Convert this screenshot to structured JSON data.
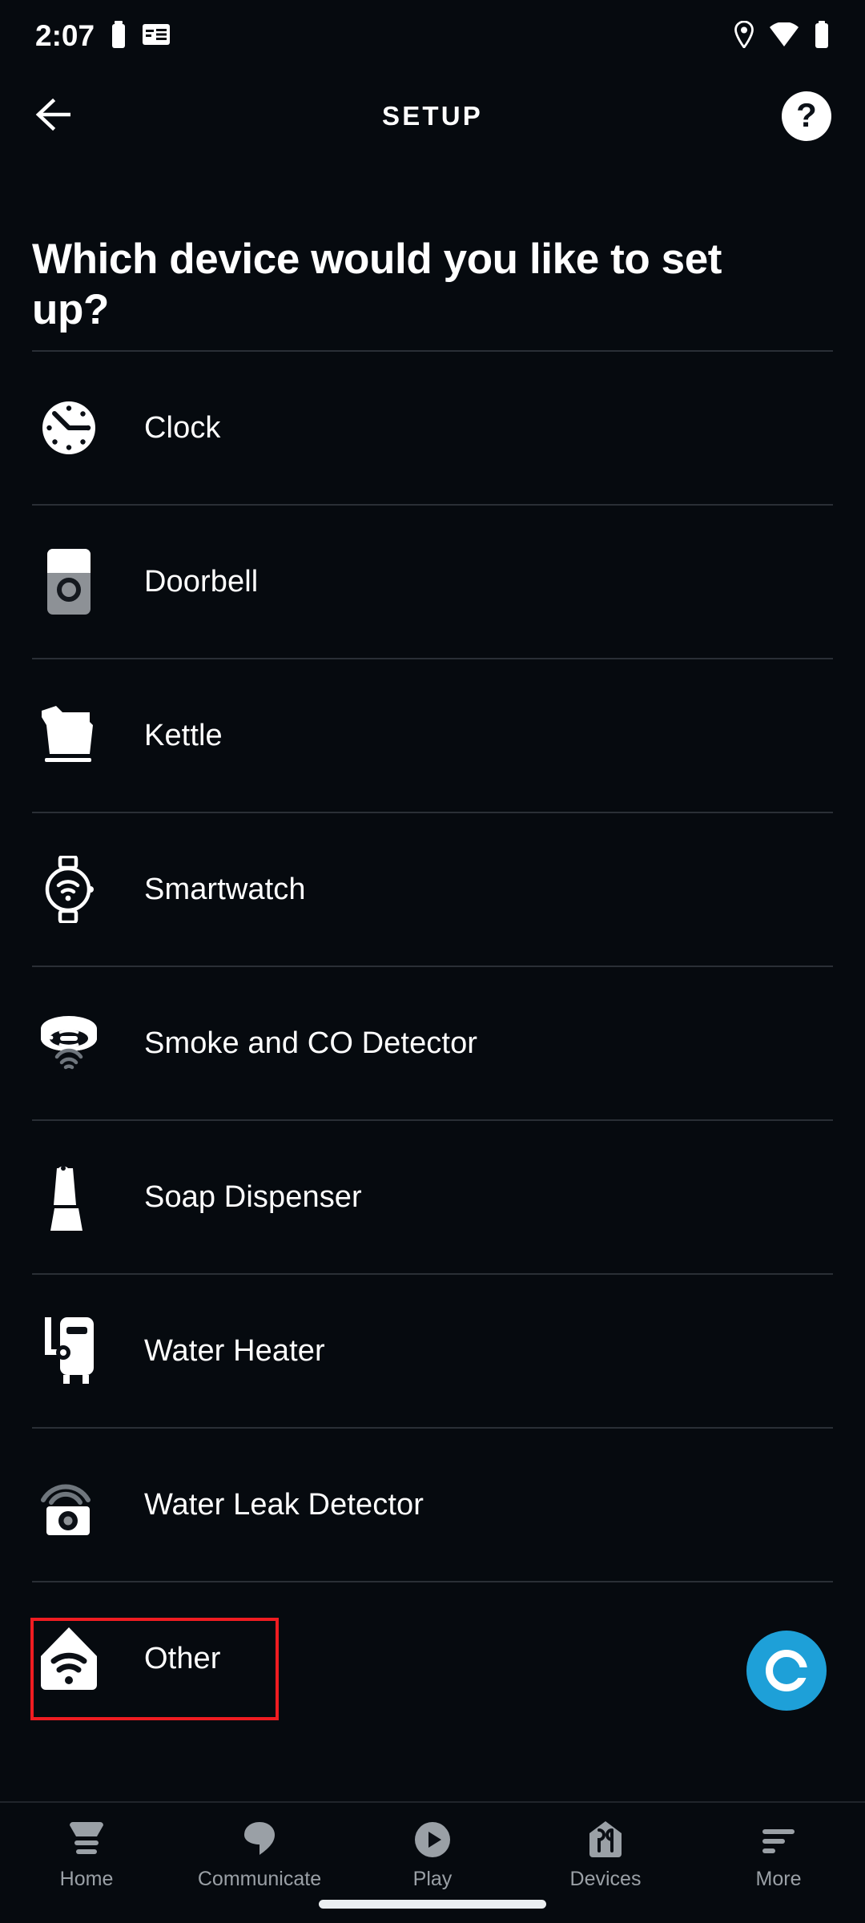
{
  "status_bar": {
    "time": "2:07",
    "left_icons": [
      "battery-small-icon",
      "news-icon"
    ],
    "right_icons": [
      "location-pin-icon",
      "wifi-icon",
      "battery-icon"
    ]
  },
  "header": {
    "title": "SETUP",
    "back_icon": "back-arrow-icon",
    "help_icon": "help-question-icon",
    "help_label": "?"
  },
  "main": {
    "heading": "Which device would you like to set up?",
    "devices": [
      {
        "label": "Clock",
        "icon": "clock-icon"
      },
      {
        "label": "Doorbell",
        "icon": "doorbell-icon"
      },
      {
        "label": "Kettle",
        "icon": "kettle-icon"
      },
      {
        "label": "Smartwatch",
        "icon": "smartwatch-icon"
      },
      {
        "label": "Smoke and CO Detector",
        "icon": "smoke-detector-icon"
      },
      {
        "label": "Soap Dispenser",
        "icon": "soap-dispenser-icon"
      },
      {
        "label": "Water Heater",
        "icon": "water-heater-icon"
      },
      {
        "label": "Water Leak Detector",
        "icon": "water-leak-detector-icon"
      },
      {
        "label": "Other",
        "icon": "other-home-wifi-icon"
      }
    ],
    "highlighted_device": "Other",
    "highlight_color": "#f01c21"
  },
  "assistant_button": {
    "icon": "alexa-icon",
    "color": "#1ea0d8"
  },
  "bottom_nav": {
    "items": [
      {
        "label": "Home",
        "icon": "home-icon"
      },
      {
        "label": "Communicate",
        "icon": "speech-bubble-icon"
      },
      {
        "label": "Play",
        "icon": "play-circle-icon"
      },
      {
        "label": "Devices",
        "icon": "devices-icon"
      },
      {
        "label": "More",
        "icon": "more-lines-icon"
      }
    ],
    "inactive_color": "#9aa0a6"
  }
}
